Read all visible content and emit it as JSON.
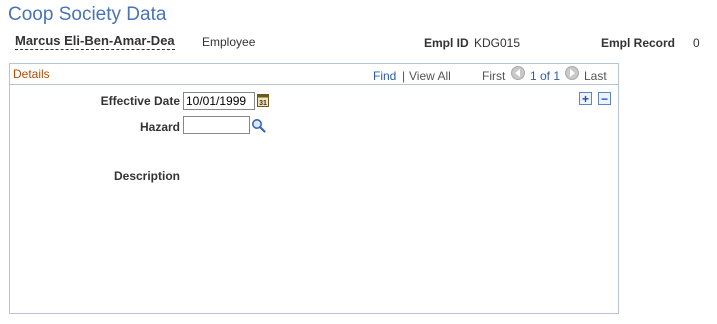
{
  "page": {
    "title": "Coop Society Data"
  },
  "employee": {
    "name": "Marcus Eli-Ben-Amar-Dea",
    "type": "Employee",
    "emplid_label": "Empl ID",
    "emplid_value": "KDG015",
    "emplrecord_label": "Empl Record",
    "emplrecord_value": "0"
  },
  "details": {
    "title": "Details",
    "find_label": "Find",
    "separator": "|",
    "view_all_label": "View All",
    "first_label": "First",
    "counter": "1 of 1",
    "last_label": "Last",
    "fields": {
      "effective_date_label": "Effective Date",
      "effective_date_value": "10/01/1999",
      "hazard_label": "Hazard",
      "hazard_value": "",
      "description_label": "Description"
    },
    "add_row_symbol": "+",
    "delete_row_symbol": "−"
  },
  "icons": {
    "calendar": "calendar-icon",
    "lookup": "lookup-icon",
    "prev": "arrow-left-icon",
    "next": "arrow-right-icon"
  },
  "colors": {
    "title": "#4a73b4",
    "section_title": "#b14b00",
    "link": "#2c5da0",
    "border": "#b7c5d9"
  }
}
